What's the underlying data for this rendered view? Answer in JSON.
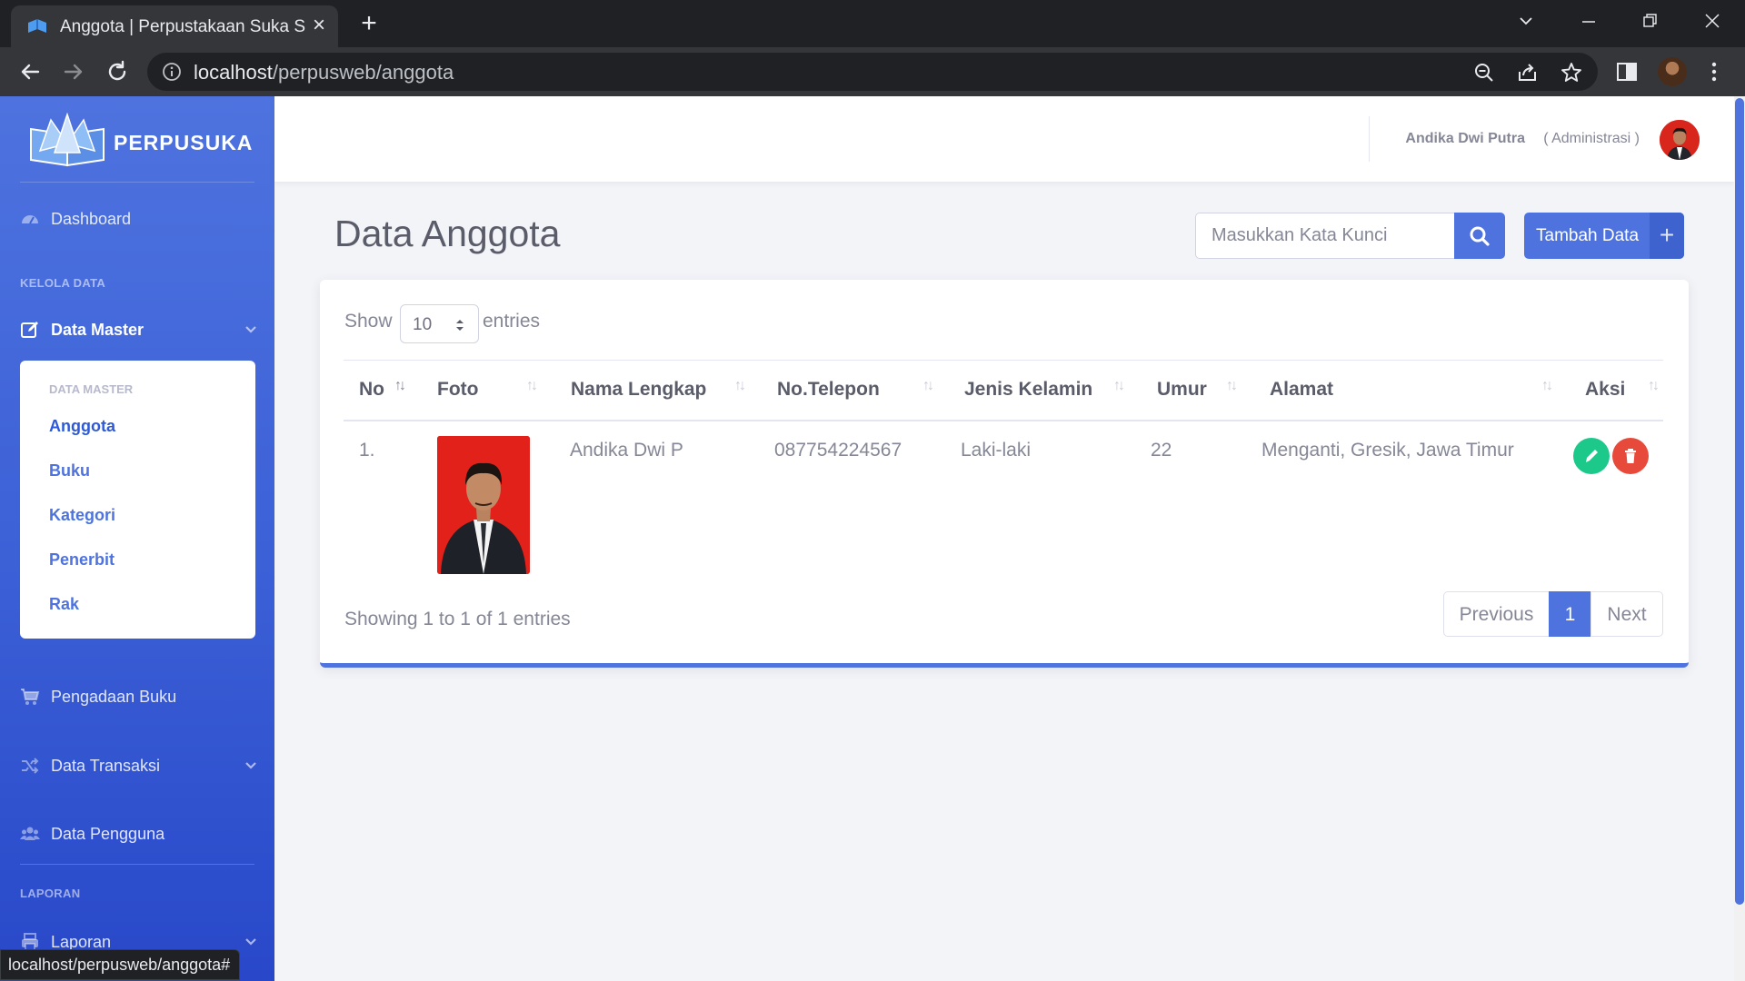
{
  "browser": {
    "tab_title": "Anggota | Perpustakaan Suka Suka",
    "url_host": "localhost",
    "url_path": "/perpusweb/anggota",
    "status_url": "localhost/perpusweb/anggota#"
  },
  "brand": {
    "name": "PERPUSUKA"
  },
  "sidebar": {
    "dashboard": "Dashboard",
    "heading_kelola": "KELOLA DATA",
    "data_master": "Data Master",
    "submenu": {
      "heading": "DATA MASTER",
      "items": [
        "Anggota",
        "Buku",
        "Kategori",
        "Penerbit",
        "Rak"
      ]
    },
    "pengadaan": "Pengadaan Buku",
    "transaksi": "Data Transaksi",
    "pengguna": "Data Pengguna",
    "heading_laporan": "LAPORAN",
    "laporan": "Laporan"
  },
  "topbar": {
    "user_name": "Andika Dwi Putra",
    "user_role": "( Administrasi )"
  },
  "page": {
    "title": "Data Anggota",
    "search_placeholder": "Masukkan Kata Kunci",
    "add_button": "Tambah Data",
    "add_icon": "+"
  },
  "table": {
    "show_label": "Show",
    "entries_label": "entries",
    "length_value": "10",
    "columns": [
      "No",
      "Foto",
      "Nama Lengkap",
      "No.Telepon",
      "Jenis Kelamin",
      "Umur",
      "Alamat",
      "Aksi"
    ],
    "rows": [
      {
        "no": "1.",
        "nama": "Andika Dwi P",
        "telepon": "087754224567",
        "jenis_kelamin": "Laki-laki",
        "umur": "22",
        "alamat": "Menganti, Gresik, Jawa Timur"
      }
    ],
    "info": "Showing 1 to 1 of 1 entries",
    "pagination": {
      "previous": "Previous",
      "current": "1",
      "next": "Next"
    }
  },
  "colors": {
    "primary": "#4e73df",
    "success": "#1cc88a",
    "danger": "#e74a3b"
  }
}
